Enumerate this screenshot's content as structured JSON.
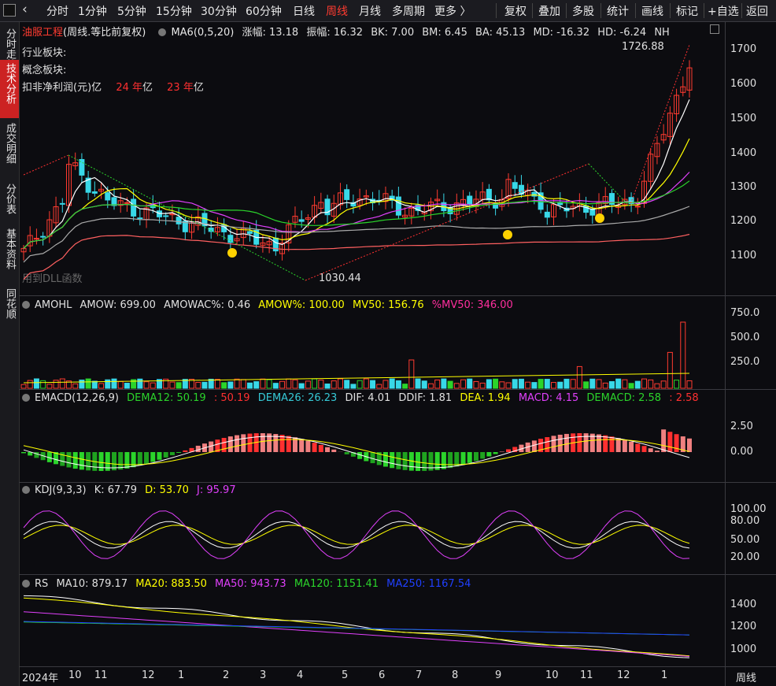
{
  "toolbar": {
    "left_tabs": [
      "分时",
      "1分钟",
      "5分钟",
      "15分钟",
      "30分钟",
      "60分钟",
      "日线",
      "周线",
      "月线",
      "多周期",
      "更多 〉"
    ],
    "active_tab": "周线",
    "right_tabs": [
      "复权",
      "叠加",
      "多股",
      "统计",
      "画线",
      "标记",
      "+自选",
      "返回"
    ]
  },
  "sidebar": {
    "items": [
      "分时走势",
      "技术分析",
      "成交明细",
      "分价表",
      "基本资料",
      "同花顺"
    ],
    "active": "技术分析"
  },
  "main_panel": {
    "stock_name": "油服工程",
    "mode": "(周线.等比前复权)",
    "indicator": "MA6(0,5,20)",
    "stats": [
      "涨幅: 13.18",
      "振幅: 16.32",
      "BK: 7.00",
      "BM: 6.45",
      "BA: 45.13",
      "MD: -16.32",
      "HD: -6.24",
      "NH"
    ],
    "info_lines": [
      "行业板块:",
      "概念板块:"
    ],
    "profit_label": "扣非净利润(元)",
    "profit_values": [
      "亿",
      "24 年",
      "亿",
      "23 年",
      "亿"
    ],
    "high_label": "1726.88",
    "low_label": "1030.44",
    "watermark": "用到DLL函数",
    "yticks": [
      "1700",
      "1600",
      "1500",
      "1400",
      "1300",
      "1200",
      "1100"
    ]
  },
  "amohl_panel": {
    "name": "AMOHL",
    "values": [
      {
        "text": "AMOW: 699.00",
        "color": "#e8e8e8"
      },
      {
        "text": "AMOWAC%: 0.46",
        "color": "#e8e8e8"
      },
      {
        "text": "AMOW%: 100.00",
        "color": "#ffff00"
      },
      {
        "text": "MV50: 156.76",
        "color": "#ffff00"
      },
      {
        "text": "%MV50: 346.00",
        "color": "#ff2e9e"
      }
    ],
    "yticks": [
      "750.0",
      "500.0",
      "250.0"
    ]
  },
  "emacd_panel": {
    "name": "EMACD(12,26,9)",
    "values": [
      {
        "text": "DEMA12: 50.19",
        "color": "#2bd42b"
      },
      {
        "text": ": 50.19",
        "color": "#ff3030"
      },
      {
        "text": "DEMA26: 26.23",
        "color": "#36c9d6"
      },
      {
        "text": "DIF: 4.01",
        "color": "#e8e8e8"
      },
      {
        "text": "DDIF: 1.81",
        "color": "#e8e8e8"
      },
      {
        "text": "DEA: 1.94",
        "color": "#ffff00"
      },
      {
        "text": "MACD: 4.15",
        "color": "#e040fb"
      },
      {
        "text": "DEMACD: 2.58",
        "color": "#2bd42b"
      },
      {
        "text": ": 2.58",
        "color": "#ff3030"
      }
    ],
    "yticks": [
      "2.50",
      "0.00"
    ]
  },
  "kdj_panel": {
    "name": "KDJ(9,3,3)",
    "values": [
      {
        "text": "K: 67.79",
        "color": "#e8e8e8"
      },
      {
        "text": "D: 53.70",
        "color": "#ffff00"
      },
      {
        "text": "J: 95.97",
        "color": "#e040fb"
      }
    ],
    "yticks": [
      "100.00",
      "80.00",
      "50.00",
      "20.00"
    ]
  },
  "rs_panel": {
    "name": "RS",
    "values": [
      {
        "text": "MA10: 879.17",
        "color": "#e8e8e8"
      },
      {
        "text": "MA20: 883.50",
        "color": "#ffff00"
      },
      {
        "text": "MA50: 943.73",
        "color": "#e040fb"
      },
      {
        "text": "MA120: 1151.41",
        "color": "#2bd42b"
      },
      {
        "text": "MA250: 1167.54",
        "color": "#2040ff"
      }
    ],
    "yticks": [
      "1400",
      "1200",
      "1000"
    ]
  },
  "x_axis": {
    "labels": [
      "2024年",
      "10",
      "11",
      "12",
      "1",
      "2",
      "3",
      "4",
      "5",
      "6",
      "7",
      "8",
      "9",
      "10",
      "11",
      "12",
      "1"
    ],
    "period_label": "周线"
  },
  "colors": {
    "up": "#ff3b30",
    "down": "#38d8e8",
    "ma_white": "#ffffff",
    "ma_yellow": "#ffff00",
    "ma_magenta": "#e040fb",
    "ma_green": "#2bd42b",
    "background": "#0c0c10"
  }
}
